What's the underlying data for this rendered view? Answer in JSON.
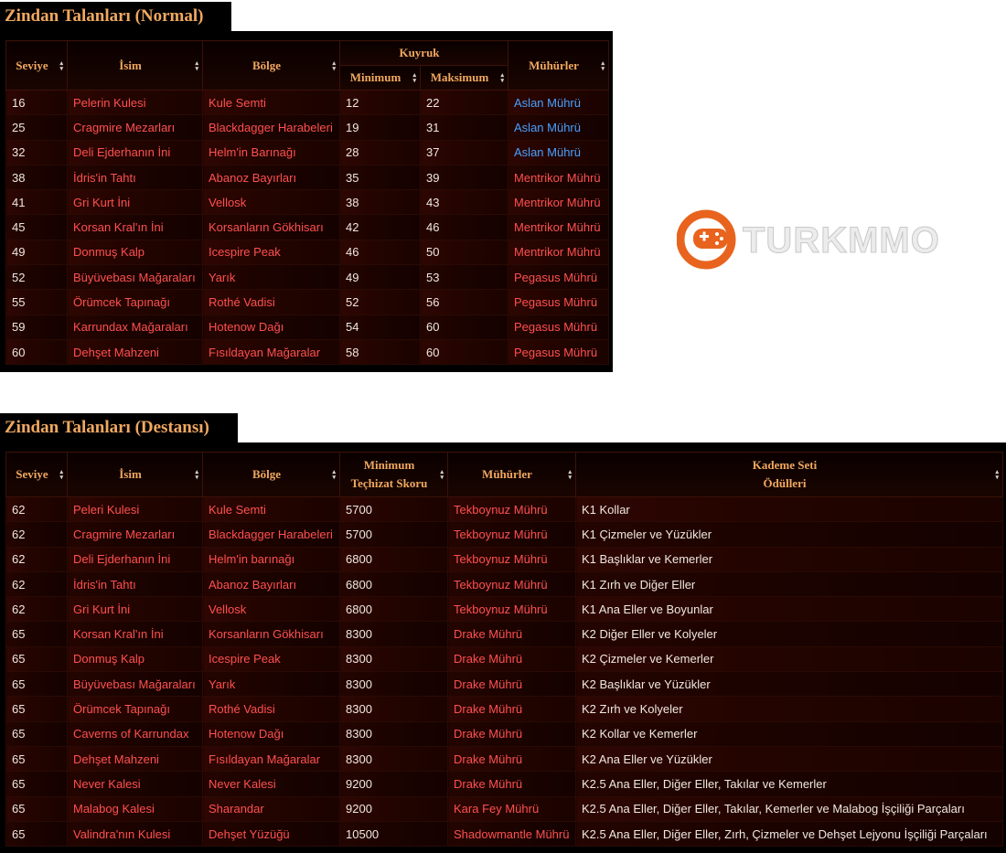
{
  "normal": {
    "title": "Zindan Talanları (Normal)",
    "headers": {
      "level": "Seviye",
      "name": "İsim",
      "region": "Bölge",
      "queue": "Kuyruk",
      "min": "Minimum",
      "max": "Maksimum",
      "seals": "Mühürler"
    },
    "rows": [
      {
        "level": "16",
        "name": "Pelerin Kulesi",
        "region": "Kule Semti",
        "min": "12",
        "max": "22",
        "seal": "Aslan Mührü",
        "seal_color": "blue"
      },
      {
        "level": "25",
        "name": "Cragmire Mezarları",
        "region": "Blackdagger Harabeleri",
        "min": "19",
        "max": "31",
        "seal": "Aslan Mührü",
        "seal_color": "blue"
      },
      {
        "level": "32",
        "name": "Deli Ejderhanın İni",
        "region": "Helm'in Barınağı",
        "min": "28",
        "max": "37",
        "seal": "Aslan Mührü",
        "seal_color": "blue"
      },
      {
        "level": "38",
        "name": "İdris'in Tahtı",
        "region": "Abanoz Bayırları",
        "min": "35",
        "max": "39",
        "seal": "Mentrikor Mührü",
        "seal_color": "red"
      },
      {
        "level": "41",
        "name": "Gri Kurt İni",
        "region": "Vellosk",
        "min": "38",
        "max": "43",
        "seal": "Mentrikor Mührü",
        "seal_color": "red"
      },
      {
        "level": "45",
        "name": "Korsan Kral'ın İni",
        "region": "Korsanların Gökhisarı",
        "min": "42",
        "max": "46",
        "seal": "Mentrikor Mührü",
        "seal_color": "red"
      },
      {
        "level": "49",
        "name": "Donmuş Kalp",
        "region": "Icespire Peak",
        "min": "46",
        "max": "50",
        "seal": "Mentrikor Mührü",
        "seal_color": "red"
      },
      {
        "level": "52",
        "name": "Büyüvebası Mağaraları",
        "region": "Yarık",
        "min": "49",
        "max": "53",
        "seal": "Pegasus Mührü",
        "seal_color": "red"
      },
      {
        "level": "55",
        "name": "Örümcek Tapınağı",
        "region": "Rothé Vadisi",
        "min": "52",
        "max": "56",
        "seal": "Pegasus Mührü",
        "seal_color": "red"
      },
      {
        "level": "59",
        "name": "Karrundax Mağaraları",
        "region": "Hotenow Dağı",
        "min": "54",
        "max": "60",
        "seal": "Pegasus Mührü",
        "seal_color": "red"
      },
      {
        "level": "60",
        "name": "Dehşet Mahzeni",
        "region": "Fısıldayan Mağaralar",
        "min": "58",
        "max": "60",
        "seal": "Pegasus Mührü",
        "seal_color": "red"
      }
    ]
  },
  "epic": {
    "title": "Zindan Talanları (Destansı)",
    "headers": {
      "level": "Seviye",
      "name": "İsim",
      "region": "Bölge",
      "gear_line1": "Minimum",
      "gear_line2": "Teçhizat Skoru",
      "seals": "Mühürler",
      "reward_line1": "Kademe Seti",
      "reward_line2": "Ödülleri"
    },
    "rows": [
      {
        "level": "62",
        "name": "Peleri Kulesi",
        "region": "Kule Semti",
        "gear": "5700",
        "seal": "Tekboynuz Mührü",
        "reward": "K1 Kollar"
      },
      {
        "level": "62",
        "name": "Cragmire Mezarları",
        "region": "Blackdagger Harabeleri",
        "gear": "5700",
        "seal": "Tekboynuz Mührü",
        "reward": "K1 Çizmeler ve Yüzükler"
      },
      {
        "level": "62",
        "name": "Deli Ejderhanın İni",
        "region": "Helm'in barınağı",
        "gear": "6800",
        "seal": "Tekboynuz Mührü",
        "reward": "K1 Başlıklar ve Kemerler"
      },
      {
        "level": "62",
        "name": "İdris'in Tahtı",
        "region": "Abanoz Bayırları",
        "gear": "6800",
        "seal": "Tekboynuz Mührü",
        "reward": "K1 Zırh ve Diğer Eller"
      },
      {
        "level": "62",
        "name": "Gri Kurt İni",
        "region": "Vellosk",
        "gear": "6800",
        "seal": "Tekboynuz Mührü",
        "reward": "K1 Ana Eller ve Boyunlar"
      },
      {
        "level": "65",
        "name": "Korsan Kral'ın İni",
        "region": "Korsanların Gökhisarı",
        "gear": "8300",
        "seal": "Drake Mührü",
        "reward": "K2 Diğer Eller ve Kolyeler"
      },
      {
        "level": "65",
        "name": "Donmuş Kalp",
        "region": "Icespire Peak",
        "gear": "8300",
        "seal": "Drake Mührü",
        "reward": "K2 Çizmeler ve Kemerler"
      },
      {
        "level": "65",
        "name": "Büyüvebası Mağaraları",
        "region": "Yarık",
        "gear": "8300",
        "seal": "Drake Mührü",
        "reward": "K2 Başlıklar ve Yüzükler"
      },
      {
        "level": "65",
        "name": "Örümcek Tapınağı",
        "region": "Rothé Vadisi",
        "gear": "8300",
        "seal": "Drake Mührü",
        "reward": "K2 Zırh ve Kolyeler"
      },
      {
        "level": "65",
        "name": "Caverns of Karrundax",
        "region": "Hotenow Dağı",
        "gear": "8300",
        "seal": "Drake Mührü",
        "reward": "K2 Kollar ve Kemerler"
      },
      {
        "level": "65",
        "name": "Dehşet Mahzeni",
        "region": "Fısıldayan Mağaralar",
        "gear": "8300",
        "seal": "Drake Mührü",
        "reward": "K2 Ana Eller ve Yüzükler"
      },
      {
        "level": "65",
        "name": "Never Kalesi",
        "region": "Never Kalesi",
        "gear": "9200",
        "seal": "Drake Mührü",
        "reward": "K2.5 Ana Eller, Diğer Eller, Takılar ve Kemerler"
      },
      {
        "level": "65",
        "name": "Malabog Kalesi",
        "region": "Sharandar",
        "gear": "9200",
        "seal": "Kara Fey Mührü",
        "reward": "K2.5 Ana Eller, Diğer Eller, Takılar, Kemerler ve Malabog İşçiliği Parçaları"
      },
      {
        "level": "65",
        "name": "Valindra'nın Kulesi",
        "region": "Dehşet Yüzüğü",
        "gear": "10500",
        "seal": "Shadowmantle Mührü",
        "reward": "K2.5 Ana Eller, Diğer Eller, Zırh, Çizmeler ve Dehşet Lejyonu İşçiliği Parçaları"
      }
    ]
  },
  "watermark": {
    "text": "TURKMMO",
    "colors": {
      "ring": "#e8641e",
      "text": "#d8d8d8"
    },
    "icon": "gamepad-logo-icon"
  },
  "colors": {
    "header_text": "#f0a860",
    "name_text": "#ff5050",
    "blue_seal": "#4aa0ff",
    "value_text": "#f0e8e0"
  }
}
